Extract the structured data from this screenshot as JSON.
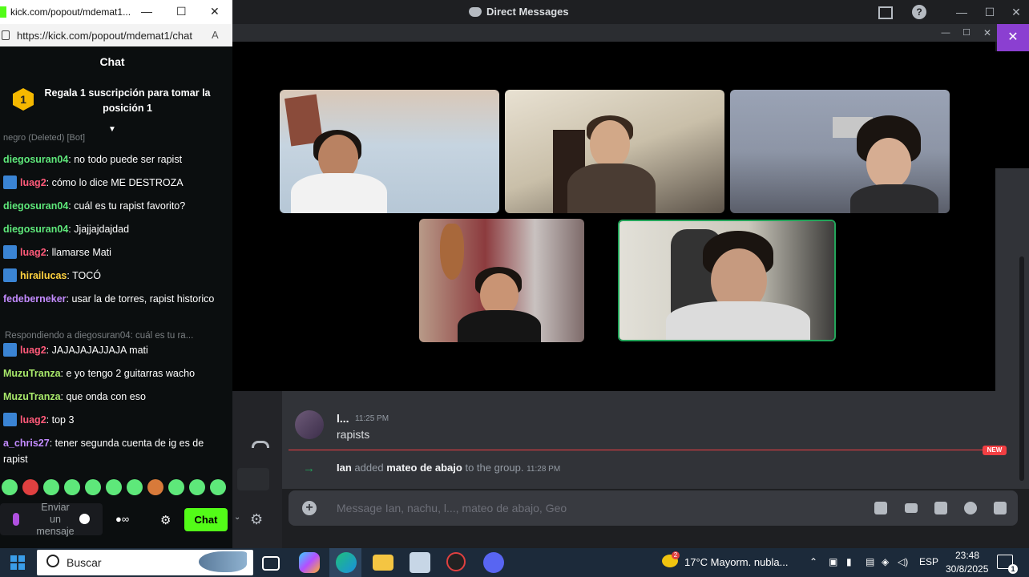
{
  "discord": {
    "title": "Direct Messages",
    "message": {
      "author": "l...",
      "time": "11:25 PM",
      "text": "rapists"
    },
    "new_badge": "NEW",
    "system": {
      "actor": "Ian",
      "verb": "added",
      "target": "mateo de abajo",
      "suffix": "to the group.",
      "time": "11:28 PM"
    },
    "composer_placeholder": "Message Ian, nachu, l..., mateo de abajo, Geo",
    "icons": [
      "plus-icon",
      "gift-icon",
      "gif-icon",
      "sticker-icon",
      "emoji-icon",
      "apps-icon"
    ],
    "participants": 5,
    "speaking_color": "#23a55a",
    "accent": "#8b3fd1"
  },
  "kick": {
    "window_title": "kick.com/popout/mdemat1...",
    "url": "https://kick.com/popout/mdemat1/chat",
    "header": "Chat",
    "pinned": {
      "rank": "1",
      "text": "Regala 1 suscripción para tomar la posición 1"
    },
    "cutoff": "negro (Deleted) [Bot]",
    "messages": [
      {
        "user": "diegosuran04",
        "color": "#5ee87a",
        "badge": false,
        "text": "no todo puede ser rapist"
      },
      {
        "user": "luag2",
        "color": "#ff5a7a",
        "badge": true,
        "text": "cómo lo dice ME DESTROZA"
      },
      {
        "user": "diegosuran04",
        "color": "#5ee87a",
        "badge": false,
        "text": "cuál es tu rapist favorito?"
      },
      {
        "user": "diegosuran04",
        "color": "#5ee87a",
        "badge": false,
        "text": "Jjajjajdajdad"
      },
      {
        "user": "luag2",
        "color": "#ff5a7a",
        "badge": true,
        "text": "llamarse Mati"
      },
      {
        "user": "hirailucas",
        "color": "#ffd23f",
        "badge": true,
        "text": "TOCÓ"
      },
      {
        "user": "fedeberneker",
        "color": "#c38bff",
        "badge": false,
        "text": "usar la de torres, rapist historico"
      },
      {
        "user": "luag2",
        "color": "#ff5a7a",
        "badge": true,
        "text": "JAJAJAJAJJAJA mati"
      },
      {
        "user": "MuzuTranza",
        "color": "#a8e86a",
        "badge": false,
        "text": "e yo tengo 2 guitarras wacho"
      },
      {
        "user": "MuzuTranza",
        "color": "#a8e86a",
        "badge": false,
        "text": "que onda con eso"
      },
      {
        "user": "luag2",
        "color": "#ff5a7a",
        "badge": true,
        "text": "top 3"
      },
      {
        "user": "a_chris27",
        "color": "#c38bff",
        "badge": false,
        "text": "tener segunda cuenta de ig es de rapist"
      }
    ],
    "reply_hint": "Respondiendo a diegosuran04: cuál es tu ra...",
    "input_placeholder": "Enviar un mensaje",
    "chat_button": "Chat",
    "brand_color": "#53fc18"
  },
  "taskbar": {
    "search": "Buscar",
    "weather_temp": "17°C",
    "weather_text": "Mayorm. nubla...",
    "weather_badge": "2",
    "lang": "ESP",
    "time": "23:48",
    "date": "30/8/2025",
    "notif_count": "1"
  }
}
